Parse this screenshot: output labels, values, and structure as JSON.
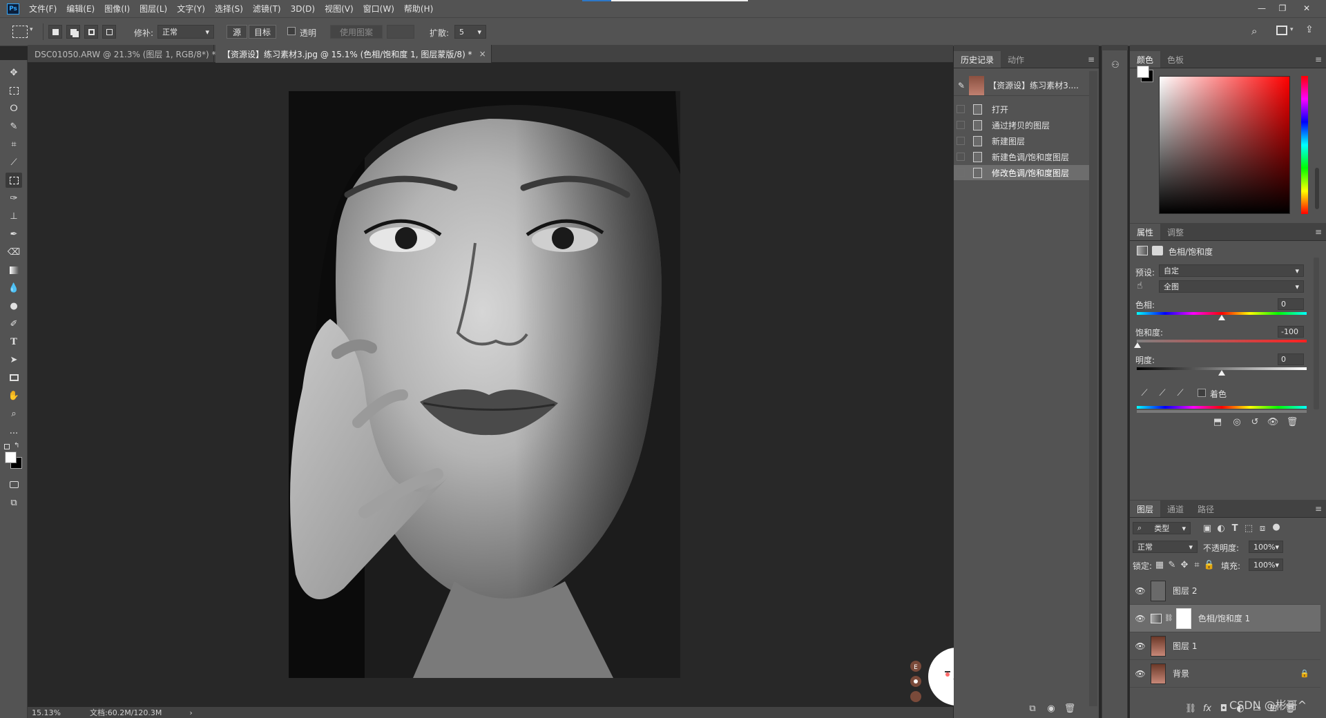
{
  "menubar": {
    "logo": "Ps",
    "items": [
      "文件(F)",
      "编辑(E)",
      "图像(I)",
      "图层(L)",
      "文字(Y)",
      "选择(S)",
      "滤镜(T)",
      "3D(D)",
      "视图(V)",
      "窗口(W)",
      "帮助(H)"
    ]
  },
  "options": {
    "patch_label": "修补:",
    "patch_value": "正常",
    "source_btn": "源",
    "target_btn": "目标",
    "transparent_label": "透明",
    "use_pattern_btn": "使用图案",
    "diffusion_label": "扩散:",
    "diffusion_value": "5"
  },
  "tabs": [
    {
      "label": "DSC01050.ARW @ 21.3% (图层 1, RGB/8*) *",
      "close": "×"
    },
    {
      "label": "【资源设】练习素材3.jpg @ 15.1% (色相/饱和度 1, 图层蒙版/8) *",
      "close": "×"
    }
  ],
  "status": {
    "zoom": "15.13%",
    "doc_info": "文档:60.2M/120.3M",
    "arrow": "›"
  },
  "history": {
    "tabs": [
      "历史记录",
      "动作"
    ],
    "snapshot_label": "【资源设】练习素材3....",
    "items": [
      "打开",
      "通过拷贝的图层",
      "新建图层",
      "新建色调/饱和度图层",
      "修改色调/饱和度图层"
    ]
  },
  "color_panel": {
    "tabs": [
      "颜色",
      "色板"
    ]
  },
  "properties": {
    "tabs": [
      "属性",
      "调整"
    ],
    "title": "色相/饱和度",
    "preset_label": "预设:",
    "preset_value": "自定",
    "range_value": "全图",
    "hue_label": "色相:",
    "hue_value": "0",
    "saturation_label": "饱和度:",
    "saturation_value": "-100",
    "lightness_label": "明度:",
    "lightness_value": "0",
    "colorize_label": "着色"
  },
  "layers_panel": {
    "tabs": [
      "图层",
      "通道",
      "路径"
    ],
    "filter_label": "类型",
    "blend_mode": "正常",
    "opacity_label": "不透明度:",
    "opacity_value": "100%",
    "lock_label": "锁定:",
    "fill_label": "填充:",
    "fill_value": "100%",
    "layers": [
      {
        "name": "图层 2"
      },
      {
        "name": "色相/饱和度 1"
      },
      {
        "name": "图层 1"
      },
      {
        "name": "背景"
      }
    ]
  },
  "watermark": "CSDN @彬哥^",
  "colors": {
    "accent_blue": "#31a8ff",
    "panel_bg": "#535353",
    "canvas_bg": "#282828",
    "selected_row": "#6d6d6d"
  }
}
